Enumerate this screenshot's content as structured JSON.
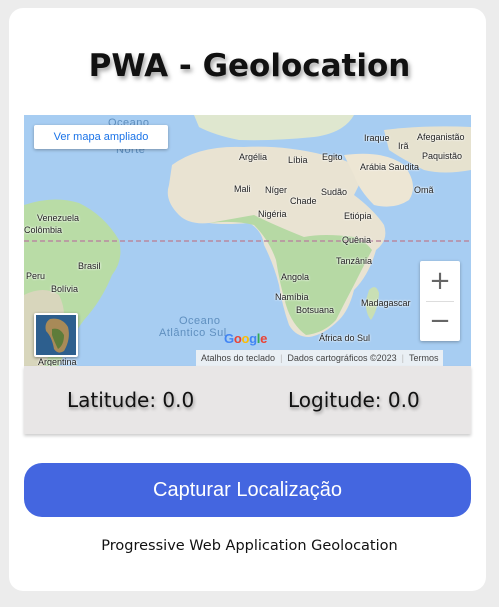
{
  "title": "PWA - Geolocation",
  "map": {
    "expand_button": "Ver mapa ampliado",
    "ocean_labels": [
      "Oceano",
      "Norte",
      "Oceano",
      "Atlântico Sul"
    ],
    "country_labels": [
      "Argélia",
      "Líbia",
      "Egito",
      "Mali",
      "Níger",
      "Chade",
      "Sudão",
      "Nigéria",
      "Etiópia",
      "Quênia",
      "Tanzânia",
      "Angola",
      "Namíbia",
      "Botsuana",
      "África do Sul",
      "Madagascar",
      "Iraque",
      "Irã",
      "Afeganistão",
      "Paquistão",
      "Arábia Saudita",
      "Omã",
      "Venezuela",
      "Colômbia",
      "Brasil",
      "Bolívia",
      "Peru",
      "Argentina"
    ],
    "attribution": [
      "Atalhos do teclado",
      "Dados cartográficos ©2023",
      "Termos"
    ],
    "google_logo": [
      "G",
      "o",
      "o",
      "g",
      "l",
      "e"
    ],
    "zoom_in": "+",
    "zoom_out": "−"
  },
  "coords": {
    "latitude_label": "Latitude:",
    "latitude_value": "0.0",
    "longitude_label": "Logitude:",
    "longitude_value": "0.0"
  },
  "capture_button": "Capturar Localização",
  "footer": "Progressive Web Application Geolocation"
}
